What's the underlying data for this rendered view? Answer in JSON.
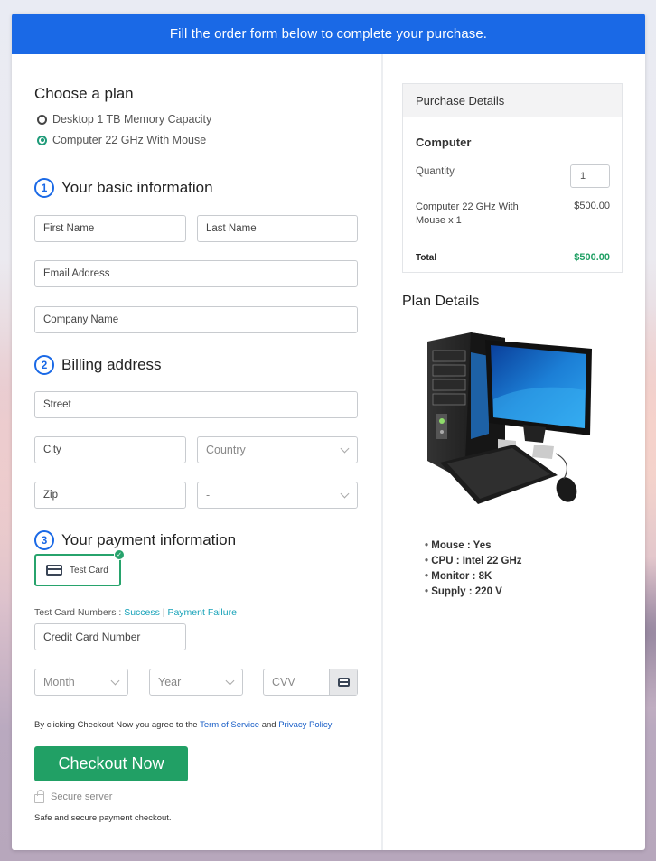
{
  "banner": {
    "text": "Fill the order form below to complete your purchase."
  },
  "plan": {
    "heading": "Choose a plan",
    "options": [
      {
        "label": "Desktop 1 TB Memory Capacity",
        "selected": false
      },
      {
        "label": "Computer 22 GHz With Mouse",
        "selected": true
      }
    ]
  },
  "basic": {
    "number": "1",
    "heading": "Your basic information",
    "first_name": "First Name",
    "last_name": "Last Name",
    "email": "Email Address",
    "company": "Company Name"
  },
  "billing": {
    "number": "2",
    "heading": "Billing address",
    "street": "Street",
    "city": "City",
    "country": "Country",
    "zip": "Zip",
    "state": "-"
  },
  "payment": {
    "number": "3",
    "heading": "Your payment information",
    "method_label": "Test Card",
    "test_numbers_label": "Test Card Numbers :",
    "success_link": "Success",
    "separator": "|",
    "failure_link": "Payment Failure",
    "card_number": "Credit Card Number",
    "month": "Month",
    "year": "Year",
    "cvv": "CVV"
  },
  "agreement": {
    "prefix": "By clicking Checkout Now you agree to the",
    "terms_link": "Term of Service",
    "and": "and",
    "privacy_link": "Privacy Policy"
  },
  "checkout": {
    "button_label": "Checkout Now",
    "secure_label": "Secure server",
    "safe_text": "Safe and secure payment checkout."
  },
  "purchase": {
    "heading": "Purchase Details",
    "product": "Computer",
    "quantity_label": "Quantity",
    "quantity": "1",
    "item_label": "Computer 22 GHz With Mouse x 1",
    "item_price": "$500.00",
    "total_label": "Total",
    "total": "$500.00"
  },
  "plan_details": {
    "heading": "Plan Details",
    "specs": [
      "Mouse : Yes",
      "CPU : Intel 22 GHz",
      "Monitor : 8K",
      "Supply : 220 V"
    ]
  },
  "colors": {
    "brand_blue": "#1a69e6",
    "success_green": "#21a065",
    "link_teal": "#17a2b8"
  }
}
